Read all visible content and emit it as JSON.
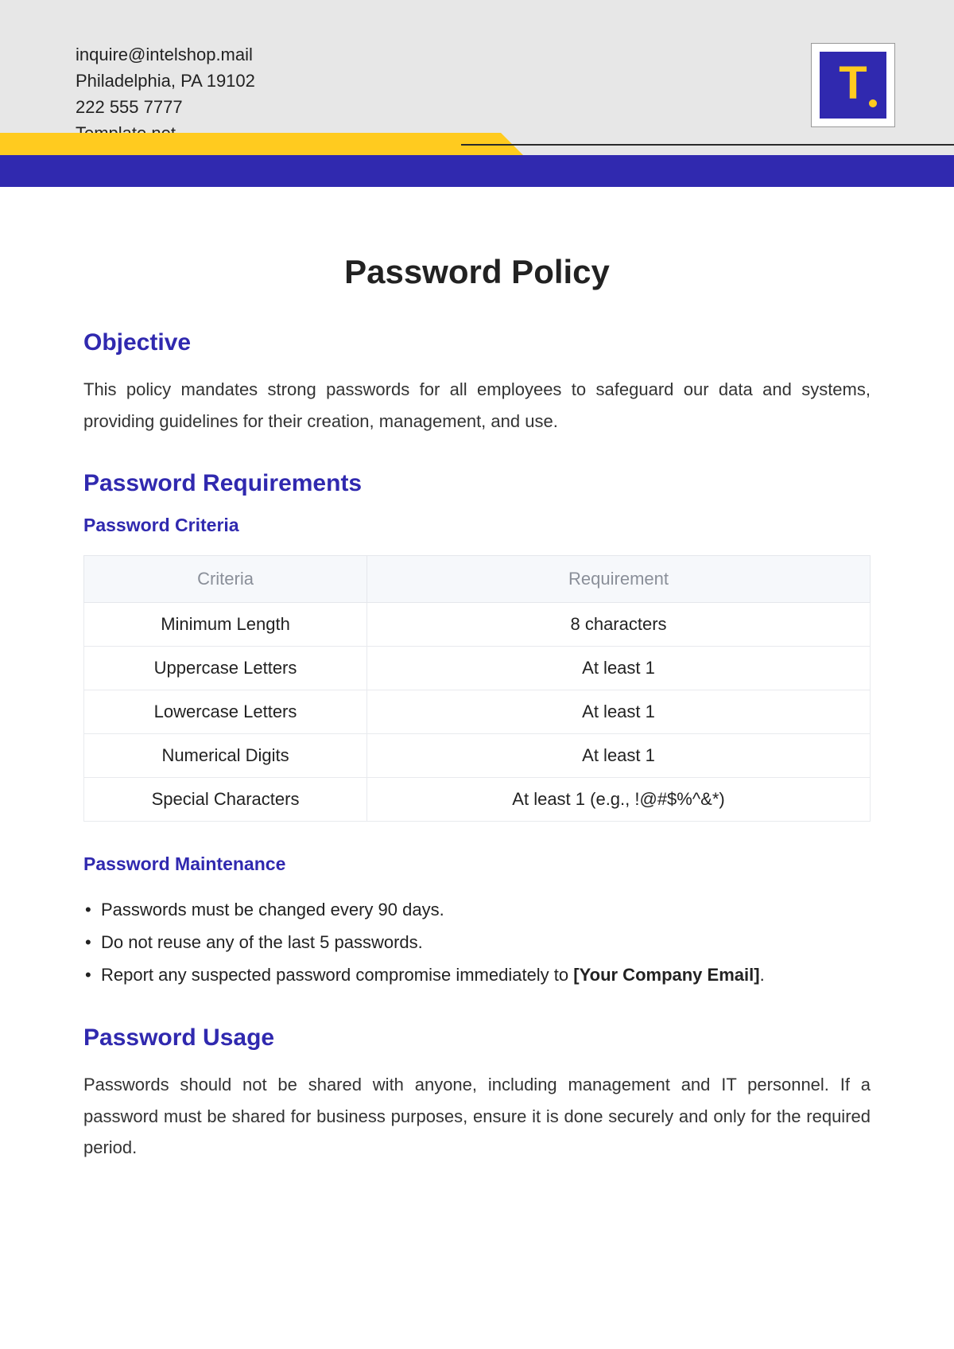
{
  "header": {
    "contact": {
      "email": "inquire@intelshop.mail",
      "address": "Philadelphia, PA 19102",
      "phone": "222 555 7777",
      "site": "Template.net"
    },
    "logo": {
      "letter": "T"
    }
  },
  "document": {
    "title": "Password Policy",
    "sections": {
      "objective": {
        "heading": "Objective",
        "text": "This policy mandates strong passwords for all employees to safeguard our data and systems, providing guidelines for their creation, management, and use."
      },
      "requirements": {
        "heading": "Password Requirements",
        "criteria_heading": "Password Criteria",
        "table": {
          "headers": [
            "Criteria",
            "Requirement"
          ],
          "rows": [
            [
              "Minimum Length",
              "8 characters"
            ],
            [
              "Uppercase Letters",
              "At least 1"
            ],
            [
              "Lowercase Letters",
              "At least 1"
            ],
            [
              "Numerical Digits",
              "At least 1"
            ],
            [
              "Special Characters",
              "At least 1 (e.g., !@#$%^&*)"
            ]
          ]
        },
        "maintenance_heading": "Password Maintenance",
        "maintenance_items": [
          {
            "text": "Passwords must be changed every 90 days."
          },
          {
            "text": "Do not reuse any of the last 5 passwords."
          },
          {
            "text": "Report any suspected password compromise immediately to ",
            "bold": "[Your Company Email]",
            "suffix": "."
          }
        ]
      },
      "usage": {
        "heading": "Password Usage",
        "text": "Passwords should not be shared with anyone, including management and IT personnel. If a password must be shared for business purposes, ensure it is done securely and only for the required period."
      }
    }
  }
}
